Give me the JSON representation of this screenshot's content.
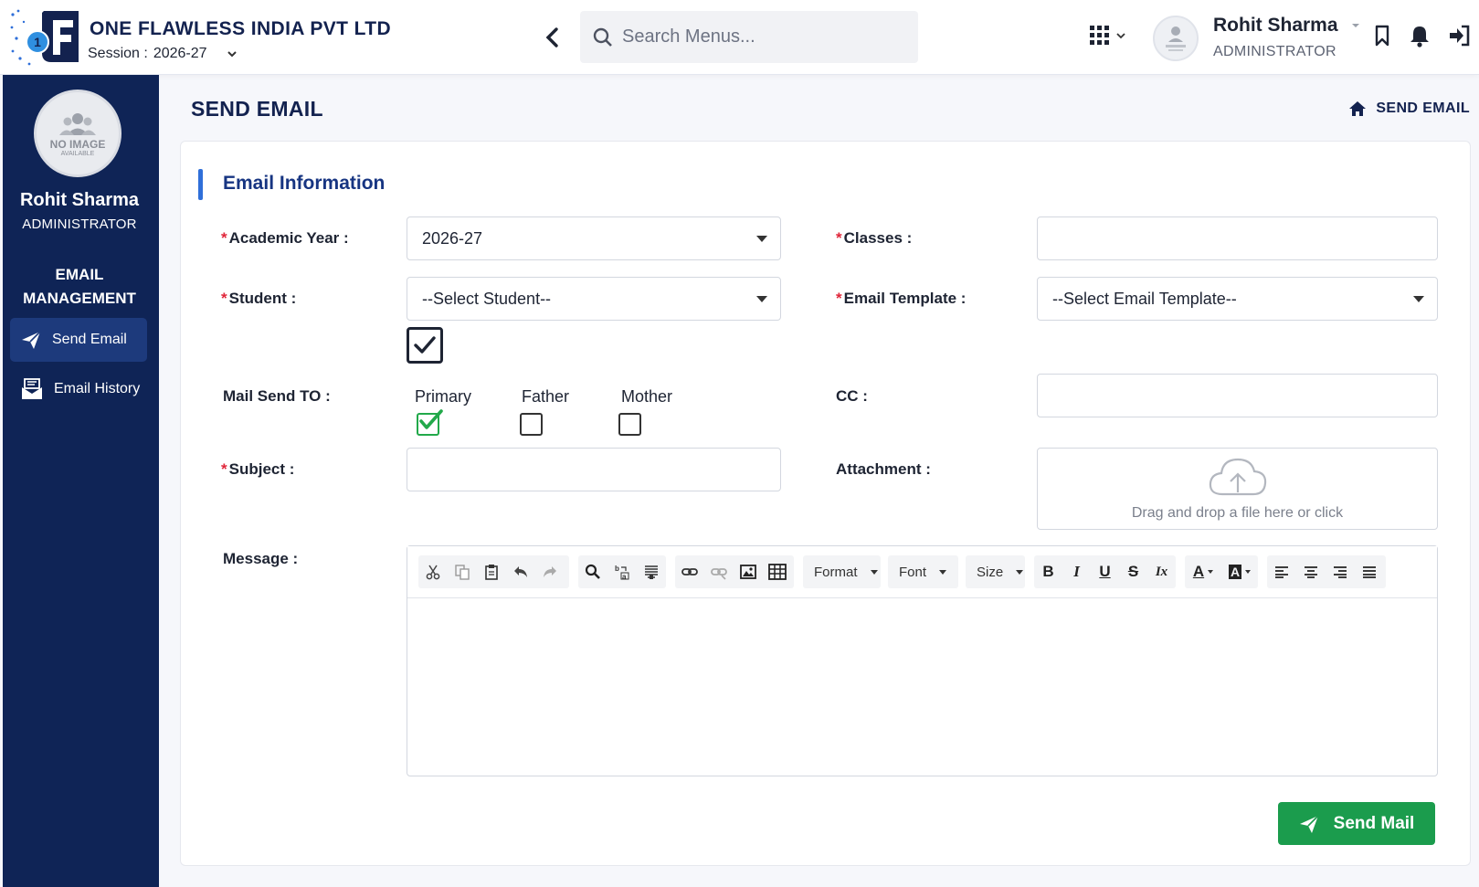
{
  "header": {
    "company_name": "ONE FLAWLESS INDIA PVT LTD",
    "session_label": "Session :",
    "session_value": "2026-27",
    "search_placeholder": "Search Menus...",
    "user_name": "Rohit Sharma",
    "user_role": "ADMINISTRATOR",
    "logo_badge": "1",
    "logo_letter": "F"
  },
  "sidebar": {
    "avatar_text": "NO IMAGE",
    "avatar_subtext": "AVAILABLE",
    "user_name": "Rohit Sharma",
    "user_role": "ADMINISTRATOR",
    "section_title_line1": "EMAIL",
    "section_title_line2": "MANAGEMENT",
    "items": [
      {
        "label": "Send Email",
        "icon": "paper-plane-icon",
        "active": true
      },
      {
        "label": "Email History",
        "icon": "mail-history-icon",
        "active": false
      }
    ]
  },
  "page": {
    "title": "SEND EMAIL",
    "breadcrumb": "SEND EMAIL"
  },
  "form": {
    "section_title": "Email Information",
    "academic_year_label": "Academic Year :",
    "academic_year_value": "2026-27",
    "classes_label": "Classes :",
    "classes_value": "",
    "student_label": "Student :",
    "student_value": "--Select Student--",
    "student_select_all_checked": true,
    "email_template_label": "Email Template :",
    "email_template_value": "--Select Email Template--",
    "mail_send_to_label": "Mail Send TO :",
    "recipients": [
      {
        "label": "Primary",
        "checked": true
      },
      {
        "label": "Father",
        "checked": false
      },
      {
        "label": "Mother",
        "checked": false
      }
    ],
    "cc_label": "CC :",
    "cc_value": "",
    "subject_label": "Subject :",
    "subject_value": "",
    "attachment_label": "Attachment :",
    "attachment_hint": "Drag and drop a file here or click",
    "message_label": "Message :",
    "required_mark": "*",
    "send_button": "Send Mail"
  },
  "editor_toolbar": {
    "format_label": "Format",
    "font_label": "Font",
    "size_label": "Size",
    "bold": "B",
    "italic": "I",
    "underline": "U",
    "strike": "S",
    "clear": "Ix",
    "text_color": "A",
    "bg_color": "A"
  },
  "colors": {
    "sidebar_bg": "#0f2456",
    "accent_blue": "#2f6fd9",
    "send_green": "#1b9c4d",
    "check_green": "#22a94a",
    "required_red": "#e0263a"
  }
}
